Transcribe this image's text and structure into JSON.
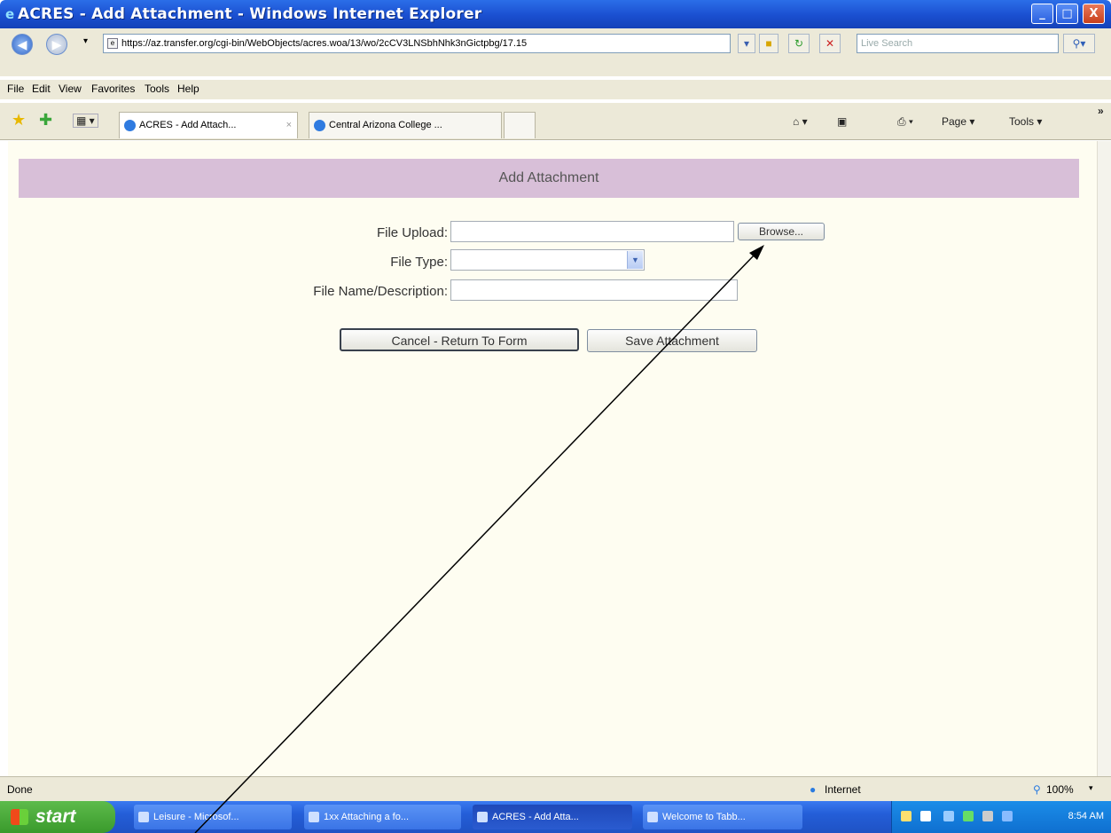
{
  "window": {
    "title": "ACRES - Add Attachment - Windows Internet Explorer",
    "min": "_",
    "max": "□",
    "close": "X"
  },
  "browser": {
    "back": "◀",
    "forward": "▶",
    "address": "https://az.transfer.org/cgi-bin/WebObjects/acres.woa/13/wo/2cCV3LNSbhNhk3nGictpbg/17.15",
    "search_placeholder": "Live Search",
    "menu": [
      "File",
      "Edit",
      "View",
      "Favorites",
      "Tools",
      "Help"
    ],
    "tabs": [
      {
        "label": "ACRES - Add Attach...",
        "close": "×"
      },
      {
        "label": "Central Arizona College ..."
      }
    ],
    "commands": {
      "home": "⌂ ▾",
      "feeds": "▣",
      "print": "⎙ ▾",
      "page": "Page ▾",
      "tools": "Tools ▾"
    }
  },
  "page": {
    "header": "Add Attachment",
    "file_upload_label": "File Upload:",
    "file_upload_value": "",
    "browse_label": "Browse...",
    "file_type_label": "File Type:",
    "file_type_value": "",
    "file_name_label": "File Name/Description:",
    "file_name_value": "",
    "cancel_label": "Cancel - Return To Form",
    "save_label": "Save Attachment"
  },
  "status": {
    "text": "Done",
    "zone": "Internet",
    "zoom": "100%"
  },
  "taskbar": {
    "start": "start",
    "items": [
      {
        "label": "Leisure - Microsof..."
      },
      {
        "label": "1xx Attaching a fo..."
      },
      {
        "label": "ACRES - Add Atta..."
      },
      {
        "label": "Welcome to Tabb..."
      }
    ],
    "clock": "8:54 AM"
  },
  "annotation": {
    "color": "#000000"
  }
}
